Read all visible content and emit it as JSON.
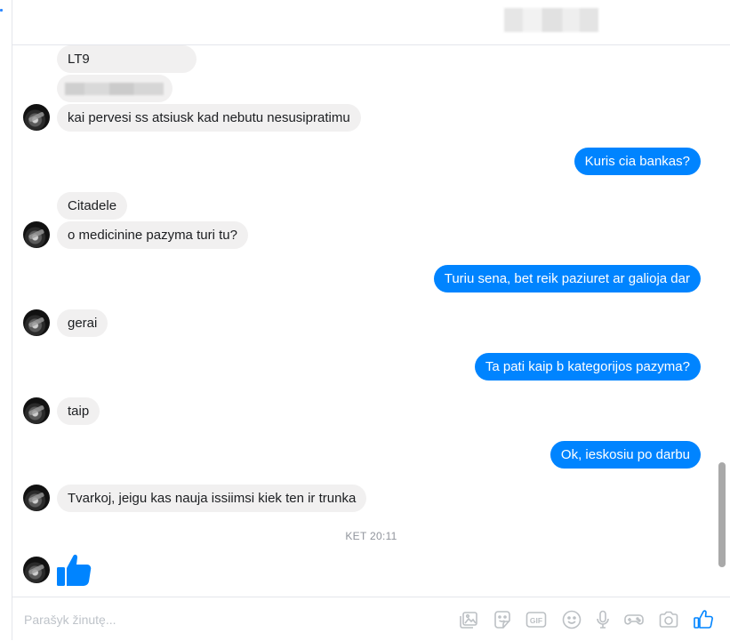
{
  "thread": {
    "messages": [
      {
        "side": "in",
        "text": "LT9"
      },
      {
        "side": "in",
        "text": "kai pervesi ss atsiusk kad nebutu nesusipratimu"
      },
      {
        "side": "out",
        "text": "Kuris cia bankas?"
      },
      {
        "side": "in",
        "text": "Citadele"
      },
      {
        "side": "in",
        "text": "o medicinine pazyma turi tu?"
      },
      {
        "side": "out",
        "text": "Turiu sena, bet reik paziuret ar galioja dar"
      },
      {
        "side": "in",
        "text": "gerai"
      },
      {
        "side": "out",
        "text": "Ta pati kaip b kategorijos pazyma?"
      },
      {
        "side": "in",
        "text": "taip"
      },
      {
        "side": "out",
        "text": "Ok, ieskosiu po darbu"
      },
      {
        "side": "in",
        "text": "Tvarkoj, jeigu kas nauja issiimsi kiek ten ir trunka"
      }
    ],
    "timestamp": "KET 20:11"
  },
  "composer": {
    "placeholder": "Parašyk žinutę...",
    "value": "",
    "tools": [
      "photos-icon",
      "sticker-icon",
      "gif-icon",
      "emoji-icon",
      "microphone-icon",
      "game-icon",
      "camera-icon",
      "like-icon"
    ],
    "gif_label": "GIF"
  },
  "colors": {
    "outgoing": "#0084ff",
    "incoming": "#f1f0f0",
    "icon": "#bcc0c4",
    "like": "#0084ff"
  }
}
